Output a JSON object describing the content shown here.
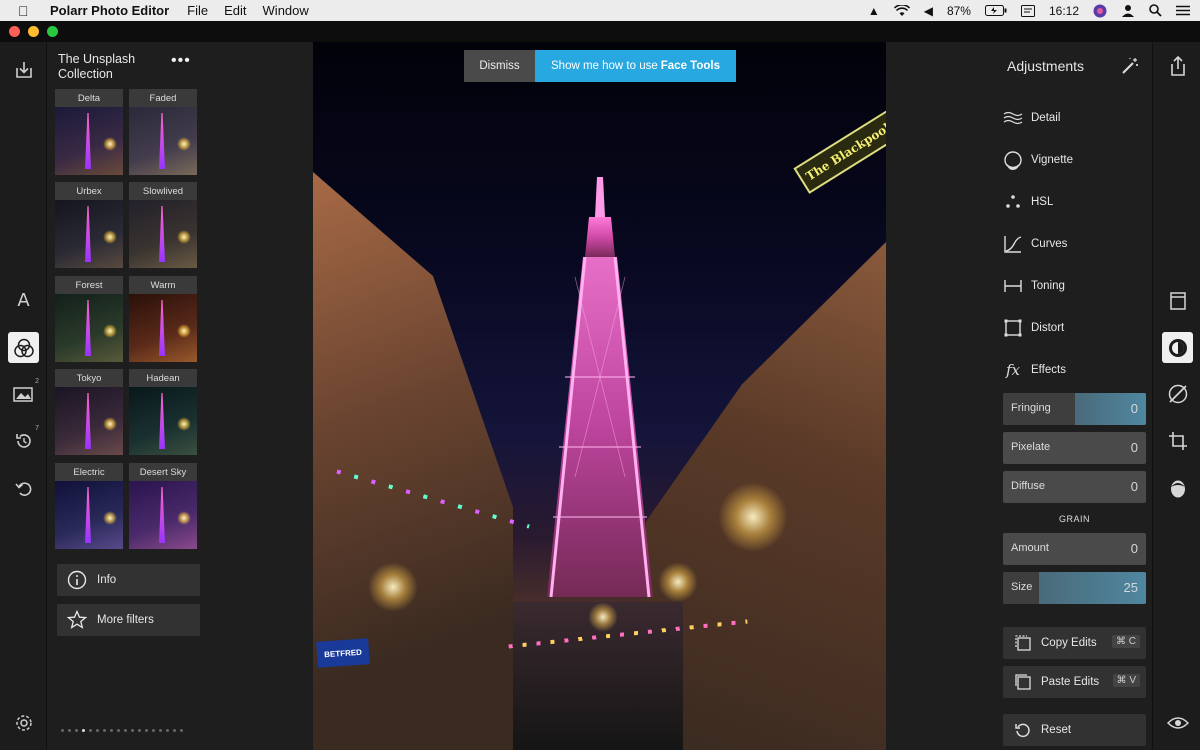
{
  "menubar": {
    "app_name": "Polarr Photo Editor",
    "menus": [
      "File",
      "Edit",
      "Window"
    ],
    "battery": "87%",
    "time": "16:12"
  },
  "filters": {
    "collection_title": "The Unsplash Collection",
    "items": [
      {
        "label": "Delta",
        "tint": "#3a2a44"
      },
      {
        "label": "Faded",
        "tint": "#433c4c"
      },
      {
        "label": "Urbex",
        "tint": "#2a2a34"
      },
      {
        "label": "Slowlived",
        "tint": "#3a3430"
      },
      {
        "label": "Forest",
        "tint": "#2a3a2a"
      },
      {
        "label": "Warm",
        "tint": "#5a2a1a"
      },
      {
        "label": "Tokyo",
        "tint": "#3a2a3a"
      },
      {
        "label": "Hadean",
        "tint": "#1a3030"
      },
      {
        "label": "Electric",
        "tint": "#2a2a5a"
      },
      {
        "label": "Desert Sky",
        "tint": "#4a2a6a"
      }
    ],
    "info_label": "Info",
    "more_filters_label": "More filters"
  },
  "banner": {
    "dismiss_label": "Dismiss",
    "how_prefix": "Show me how to use",
    "how_bold": "Face Tools"
  },
  "photo": {
    "sign_text": "The Blackpool"
  },
  "adjustments": {
    "title": "Adjustments",
    "items": [
      "Detail",
      "Vignette",
      "HSL",
      "Curves",
      "Toning",
      "Distort",
      "Effects"
    ],
    "sliders": [
      {
        "label": "Fringing",
        "value": "0",
        "level": 0.5
      },
      {
        "label": "Pixelate",
        "value": "0",
        "level": 0
      },
      {
        "label": "Diffuse",
        "value": "0",
        "level": 0
      }
    ],
    "grain_title": "GRAIN",
    "grain_sliders": [
      {
        "label": "Amount",
        "value": "0",
        "level": 0
      },
      {
        "label": "Size",
        "value": "25",
        "level": 0.25
      }
    ],
    "copy_label": "Copy Edits",
    "copy_kbd": "⌘ C",
    "paste_label": "Paste Edits",
    "paste_kbd": "⌘ V",
    "reset_label": "Reset"
  },
  "rail_left": {
    "badge_images": "2",
    "badge_history": "7"
  },
  "colors": {
    "accent": "#28a8e0",
    "panel": "#1e1e1e",
    "button": "#323232"
  }
}
